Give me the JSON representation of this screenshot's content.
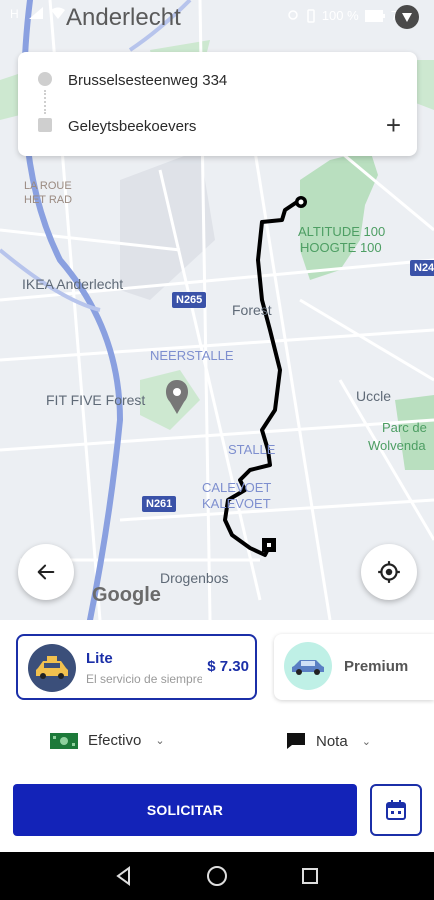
{
  "status_bar": {
    "city": "Anderlecht",
    "battery": "100 %",
    "time": "7:57"
  },
  "map": {
    "labels": {
      "forest": "Forest",
      "uccle": "Uccle",
      "neerstalle": "NEERSTALLE",
      "stalle": "STALLE",
      "calevoet": "CALEVOET",
      "kalevoet": "KALEVOET",
      "drogenbos": "Drogenbos",
      "ikea": "IKEA Anderlecht",
      "fit_five": "FIT FIVE Forest",
      "altitude_1": "ALTITUDE 100",
      "altitude_2": "HOOGTE 100",
      "parc_1": "Parc de",
      "parc_2": "Wolvenda",
      "la_roue_1": "LA ROUE",
      "la_roue_2": "HET RAD",
      "n265": "N265",
      "n261": "N261",
      "n24": "N24",
      "google": "Google"
    }
  },
  "route": {
    "origin": "Brusselsesteenweg 334",
    "destination": "Geleytsbeekoevers",
    "add_label": "+"
  },
  "services": [
    {
      "name": "Lite",
      "description": "El servicio de siempre",
      "price": "$ 7.30",
      "selected": true
    },
    {
      "name": "Premium",
      "selected": false
    }
  ],
  "options": {
    "payment": "Efectivo",
    "note": "Nota"
  },
  "actions": {
    "request": "SOLICITAR"
  },
  "colors": {
    "brand": "#1323b8",
    "route": "#000000",
    "park": "#c8e6c9"
  }
}
